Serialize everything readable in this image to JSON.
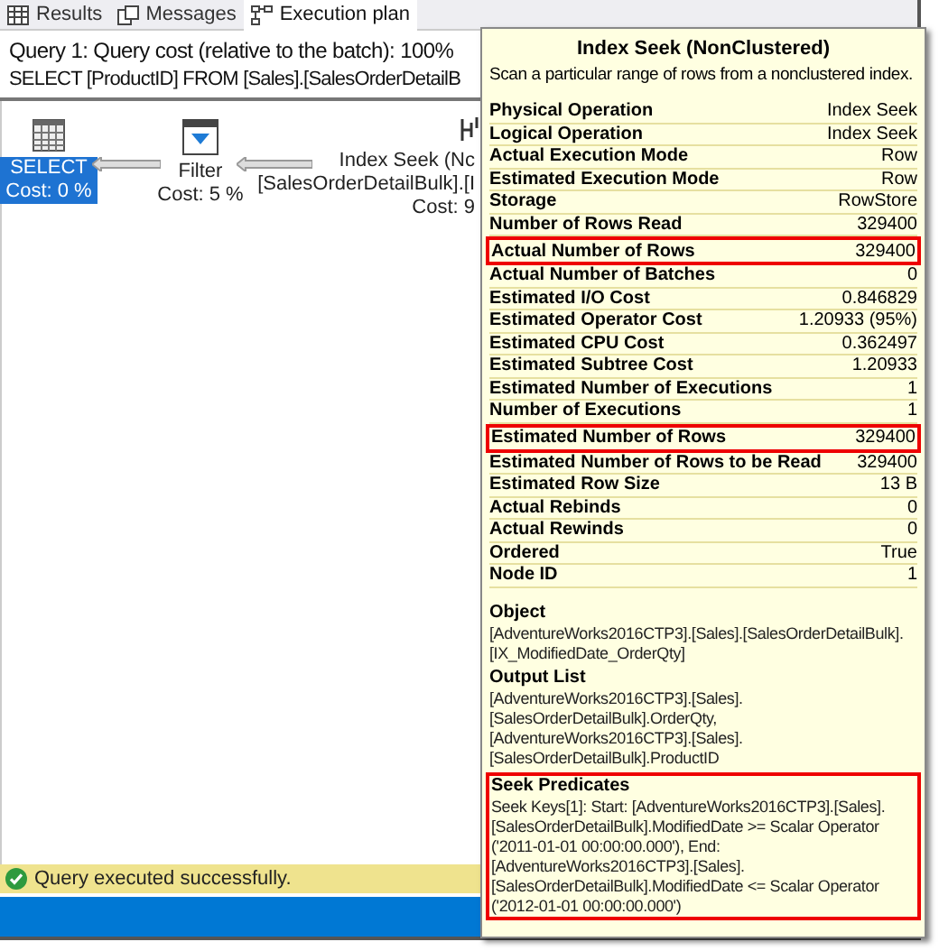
{
  "tabs": [
    {
      "label": "Results",
      "kind": "grid",
      "selected": false
    },
    {
      "label": "Messages",
      "kind": "messages",
      "selected": false
    },
    {
      "label": "Execution plan",
      "kind": "plan",
      "selected": true
    }
  ],
  "query": {
    "cost_line": "Query 1: Query cost (relative to the batch): 100%",
    "sql": "SELECT [ProductID] FROM [Sales].[SalesOrderDetailB"
  },
  "plan_nodes": [
    {
      "kind": "select",
      "lines": [
        "SELECT",
        "Cost: 0 %"
      ],
      "selected": true
    },
    {
      "kind": "filter",
      "lines": [
        "Filter",
        "Cost: 5 %"
      ],
      "selected": false
    },
    {
      "kind": "seek",
      "lines": [
        "Index Seek (Nc",
        "[SalesOrderDetailBulk].[I",
        "Cost: 9"
      ],
      "selected": false
    }
  ],
  "status_bar": {
    "message": "Query executed successfully."
  },
  "tooltip": {
    "title": "Index Seek (NonClustered)",
    "description": "Scan a particular range of rows from a nonclustered index.",
    "properties": [
      {
        "name": "Physical Operation",
        "value": "Index Seek",
        "highlighted": false
      },
      {
        "name": "Logical Operation",
        "value": "Index Seek",
        "highlighted": false
      },
      {
        "name": "Actual Execution Mode",
        "value": "Row",
        "highlighted": false
      },
      {
        "name": "Estimated Execution Mode",
        "value": "Row",
        "highlighted": false
      },
      {
        "name": "Storage",
        "value": "RowStore",
        "highlighted": false
      },
      {
        "name": "Number of Rows Read",
        "value": "329400",
        "highlighted": false
      },
      {
        "name": "Actual Number of Rows",
        "value": "329400",
        "highlighted": true
      },
      {
        "name": "Actual Number of Batches",
        "value": "0",
        "highlighted": false
      },
      {
        "name": "Estimated I/O Cost",
        "value": "0.846829",
        "highlighted": false
      },
      {
        "name": "Estimated Operator Cost",
        "value": "1.20933 (95%)",
        "highlighted": false
      },
      {
        "name": "Estimated CPU Cost",
        "value": "0.362497",
        "highlighted": false
      },
      {
        "name": "Estimated Subtree Cost",
        "value": "1.20933",
        "highlighted": false
      },
      {
        "name": "Estimated Number of Executions",
        "value": "1",
        "highlighted": false
      },
      {
        "name": "Number of Executions",
        "value": "1",
        "highlighted": false
      },
      {
        "name": "Estimated Number of Rows",
        "value": "329400",
        "highlighted": true
      },
      {
        "name": "Estimated Number of Rows to be Read",
        "value": "329400",
        "highlighted": false
      },
      {
        "name": "Estimated Row Size",
        "value": "13 B",
        "highlighted": false
      },
      {
        "name": "Actual Rebinds",
        "value": "0",
        "highlighted": false
      },
      {
        "name": "Actual Rewinds",
        "value": "0",
        "highlighted": false
      },
      {
        "name": "Ordered",
        "value": "True",
        "highlighted": false
      },
      {
        "name": "Node ID",
        "value": "1",
        "highlighted": false
      }
    ],
    "sections": [
      {
        "heading": "Object",
        "lines": [
          "[AdventureWorks2016CTP3].[Sales].[SalesOrderDetailBulk].",
          "[IX_ModifiedDate_OrderQty]"
        ],
        "highlighted": false
      },
      {
        "heading": "Output List",
        "lines": [
          "[AdventureWorks2016CTP3].[Sales].",
          "[SalesOrderDetailBulk].OrderQty,",
          "[AdventureWorks2016CTP3].[Sales].",
          "[SalesOrderDetailBulk].ProductID"
        ],
        "highlighted": false
      },
      {
        "heading": "Seek Predicates",
        "lines": [
          "Seek Keys[1]: Start: [AdventureWorks2016CTP3].[Sales].",
          "[SalesOrderDetailBulk].ModifiedDate >= Scalar Operator",
          "('2011-01-01 00:00:00.000'), End:",
          "[AdventureWorks2016CTP3].[Sales].",
          "[SalesOrderDetailBulk].ModifiedDate <= Scalar Operator",
          "('2012-01-01 00:00:00.000')"
        ],
        "highlighted": true
      }
    ]
  }
}
